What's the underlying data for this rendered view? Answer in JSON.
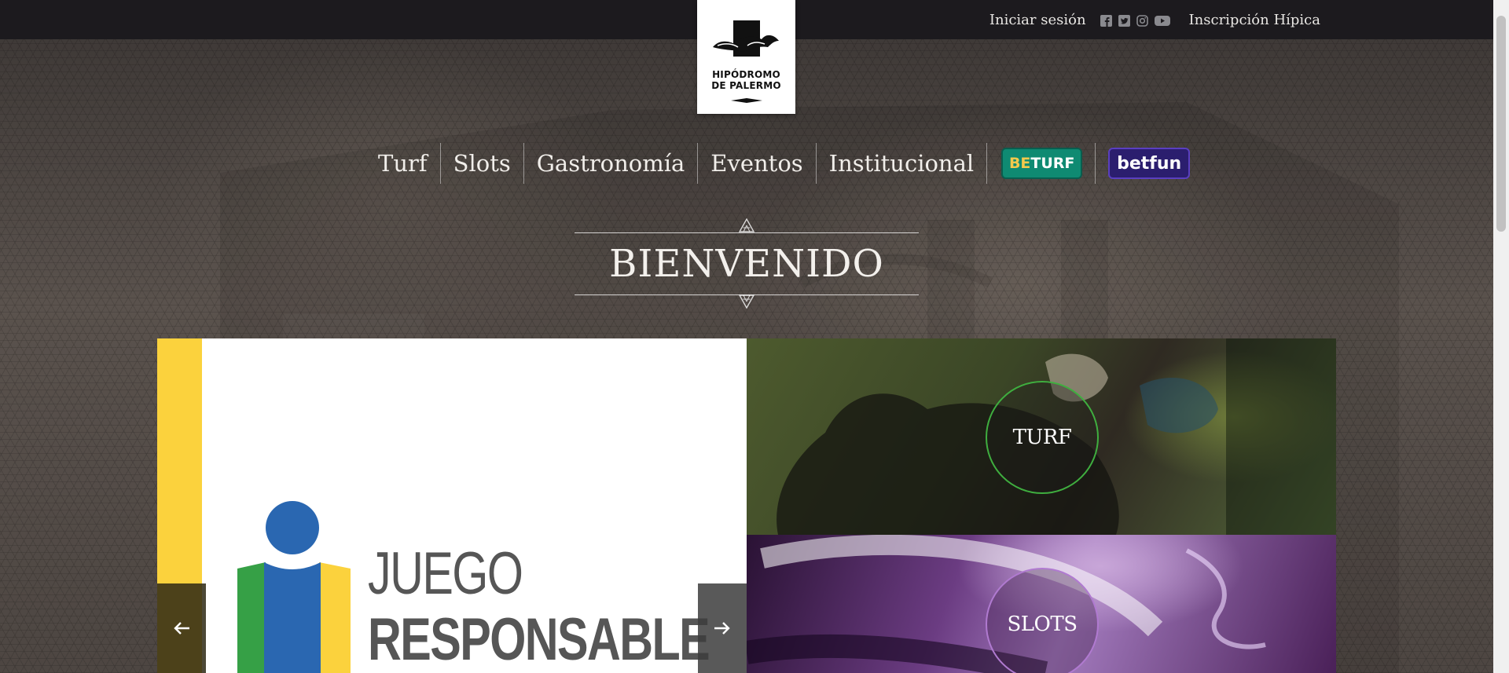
{
  "topbar": {
    "login_label": "Iniciar sesión",
    "social_icons": [
      "facebook-icon",
      "twitter-icon",
      "instagram-icon",
      "youtube-icon"
    ],
    "registration_label": "Inscripción Hípica"
  },
  "logo": {
    "line1": "HIPÓDROMO",
    "line2": "DE PALERMO"
  },
  "nav": {
    "items": [
      "Turf",
      "Slots",
      "Gastronomía",
      "Eventos",
      "Institucional"
    ],
    "beturf_be": "BE",
    "beturf_turf": "TURF",
    "betfun": "betfun"
  },
  "welcome": {
    "title": "BIENVENIDO"
  },
  "slider": {
    "line1": "JUEGO",
    "line2": "RESPONSABLE"
  },
  "tiles": {
    "turf_label": "TURF",
    "slots_label": "SLOTS"
  },
  "colors": {
    "topbar": "#1c1a1e",
    "beturf": "#0f8a72",
    "betfun": "#2b1e6e",
    "yellow": "#fbd23d",
    "jr_blue": "#2a67b1",
    "jr_green": "#36a046",
    "turf_ring": "#3fae3f",
    "slots_ring": "#b07ad0"
  }
}
